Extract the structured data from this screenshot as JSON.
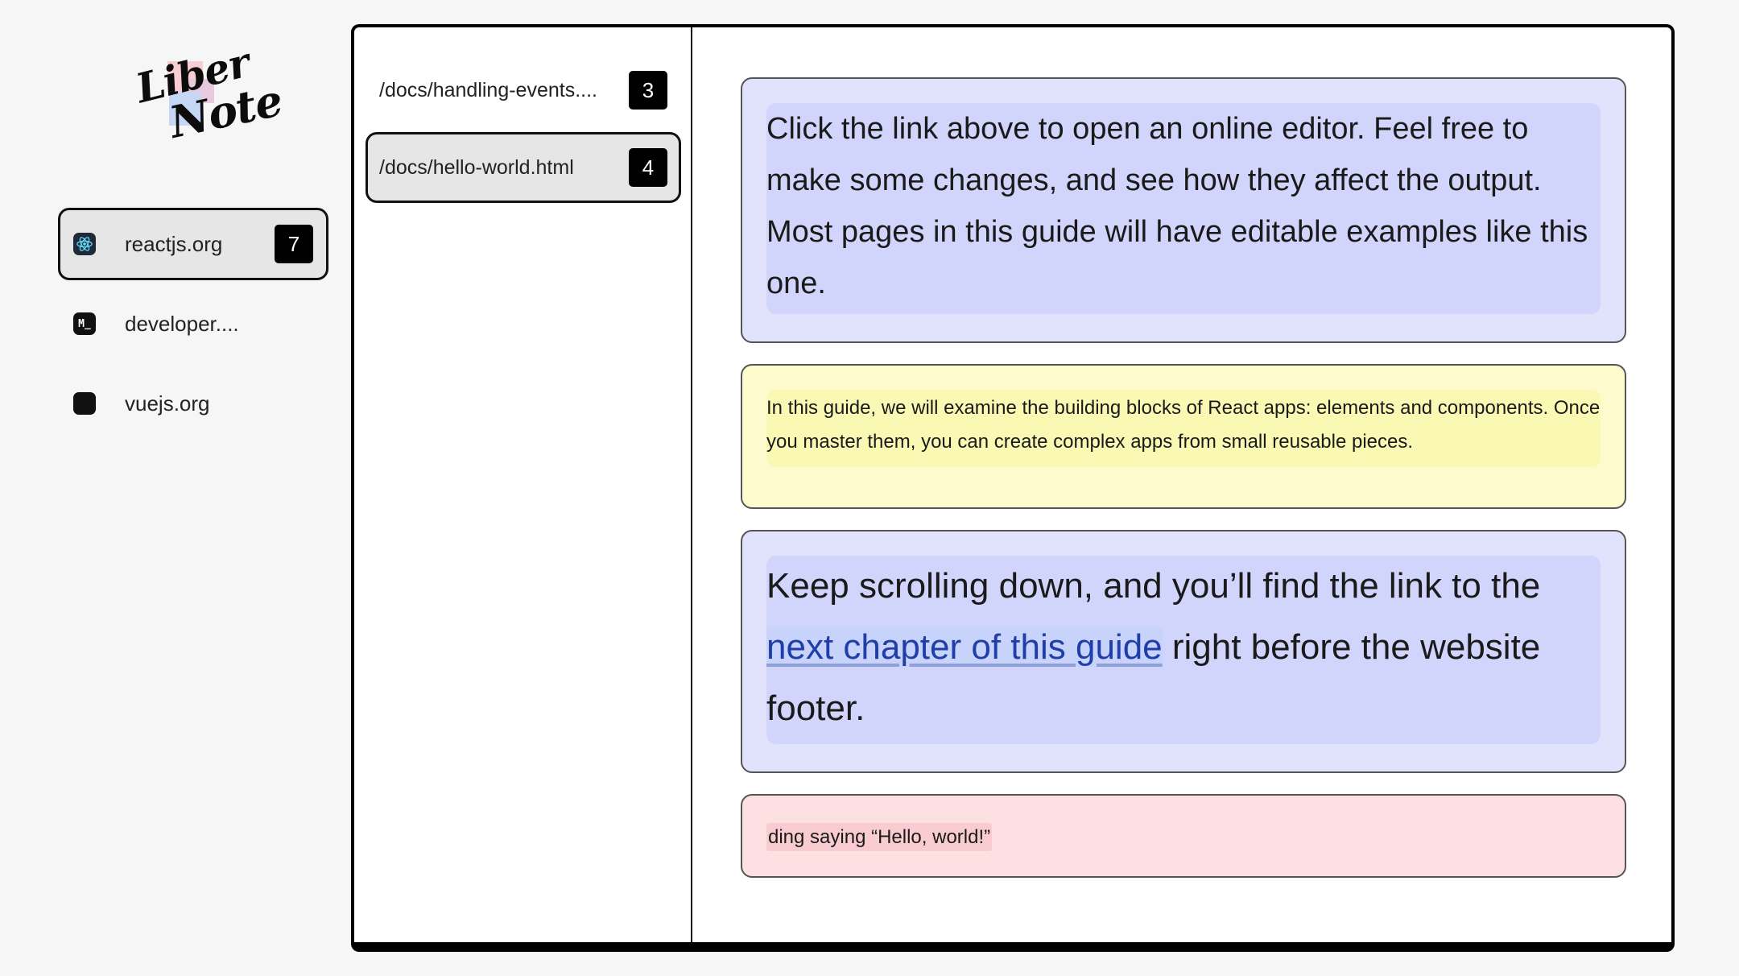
{
  "logo": {
    "line1": "Liber",
    "line2": "Note"
  },
  "sites": [
    {
      "label": "reactjs.org",
      "count": "7",
      "icon": "react-icon",
      "active": true
    },
    {
      "label": "developer....",
      "icon": "mdn-icon",
      "icon_text": "M_",
      "active": false
    },
    {
      "label": "vuejs.org",
      "icon": "vue-icon",
      "active": false
    }
  ],
  "pages": [
    {
      "label": "/docs/handling-events....",
      "count": "3",
      "active": false
    },
    {
      "label": "/docs/hello-world.html",
      "count": "4",
      "active": true
    }
  ],
  "notes": [
    {
      "color": "#e1e3fd",
      "text": "Click the link above to open an online editor. Feel free to make some changes, and see how they affect the output. Most pages in this guide will have editable examples like this one."
    },
    {
      "color": "#fdfbcd",
      "text": "In this guide, we will examine the building blocks of React apps: elements and components. Once you master them, you can create complex apps from small reusable pieces."
    },
    {
      "color": "#e1e3fd",
      "text_before": "Keep scrolling down, and you’ll find the link to the ",
      "link": "next chapter of this guide",
      "text_after": " right before the website footer."
    },
    {
      "color": "#fde0e2",
      "text": "ding saying “Hello, world!”"
    }
  ]
}
